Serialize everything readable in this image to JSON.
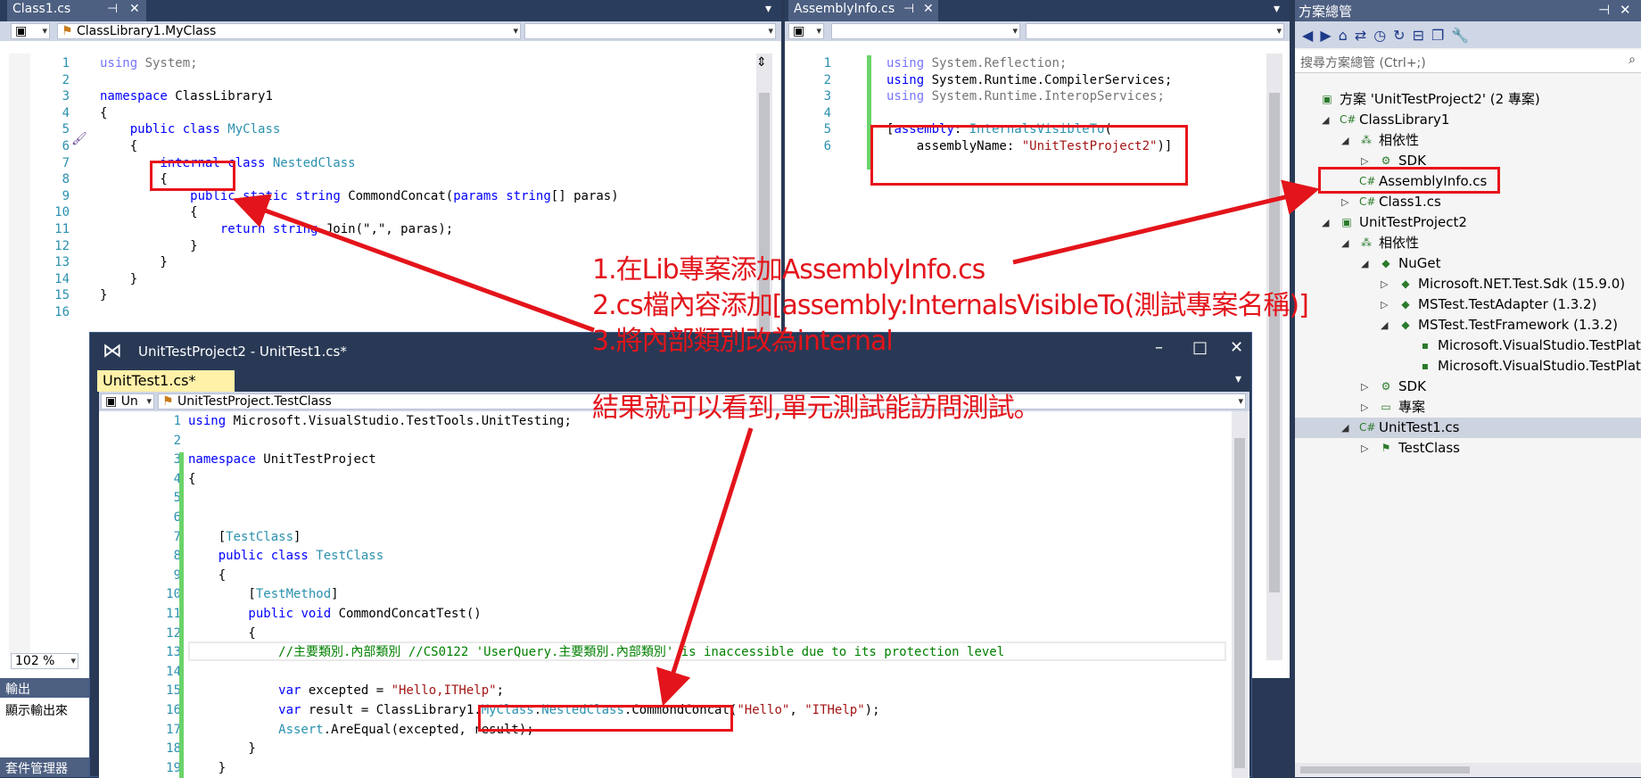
{
  "left_editor": {
    "tab": "Class1.cs",
    "nav_left": "",
    "nav_mid": "ClassLibrary1.MyClass",
    "nav_right": "",
    "zoom": "102 %",
    "gutter": [
      "1",
      "2",
      "3",
      "4",
      "5",
      "6",
      "7",
      "8",
      "9",
      "10",
      "11",
      "12",
      "13",
      "14",
      "15",
      "16"
    ],
    "lines": [
      [
        {
          "t": "using ",
          "c": "kw dim"
        },
        {
          "t": "System;",
          "c": "dim"
        }
      ],
      [],
      [
        {
          "t": "namespace ",
          "c": "kw"
        },
        {
          "t": "ClassLibrary1",
          "c": ""
        }
      ],
      [
        {
          "t": "{",
          "c": ""
        }
      ],
      [
        {
          "t": "    public ",
          "c": "kw"
        },
        {
          "t": "class ",
          "c": "kw"
        },
        {
          "t": "MyClass",
          "c": "ty"
        }
      ],
      [
        {
          "t": "    {",
          "c": ""
        }
      ],
      [
        {
          "t": "        internal ",
          "c": "kw"
        },
        {
          "t": "class ",
          "c": "kw"
        },
        {
          "t": "NestedClass",
          "c": "ty"
        }
      ],
      [
        {
          "t": "        {",
          "c": ""
        }
      ],
      [
        {
          "t": "            public ",
          "c": "kw"
        },
        {
          "t": "static ",
          "c": "kw"
        },
        {
          "t": "string ",
          "c": "kw"
        },
        {
          "t": "CommondConcat(",
          "c": ""
        },
        {
          "t": "params ",
          "c": "kw"
        },
        {
          "t": "string",
          "c": "kw"
        },
        {
          "t": "[] paras)",
          "c": ""
        }
      ],
      [
        {
          "t": "            {",
          "c": ""
        }
      ],
      [
        {
          "t": "                return ",
          "c": "kw"
        },
        {
          "t": "string",
          "c": "kw"
        },
        {
          "t": ".Join(\",\", paras);",
          "c": ""
        }
      ],
      [
        {
          "t": "            }",
          "c": ""
        }
      ],
      [
        {
          "t": "        }",
          "c": ""
        }
      ],
      [
        {
          "t": "    }",
          "c": ""
        }
      ],
      [
        {
          "t": "}",
          "c": ""
        }
      ],
      []
    ]
  },
  "output": {
    "title": "輸出",
    "label": "顯示輸出來",
    "pkg": "套件管理器"
  },
  "mid_editor": {
    "tab": "AssemblyInfo.cs",
    "gutter": [
      "1",
      "2",
      "3",
      "4",
      "5",
      "6"
    ],
    "lines": [
      [
        {
          "t": "using ",
          "c": "kw dim"
        },
        {
          "t": "System.Reflection;",
          "c": "dim"
        }
      ],
      [
        {
          "t": "using ",
          "c": "kw"
        },
        {
          "t": "System.Runtime.CompilerServices;",
          "c": ""
        }
      ],
      [
        {
          "t": "using ",
          "c": "kw dim"
        },
        {
          "t": "System.Runtime.InteropServices;",
          "c": "dim"
        }
      ],
      [],
      [
        {
          "t": "[",
          "c": ""
        },
        {
          "t": "assembly",
          "c": "kw"
        },
        {
          "t": ": ",
          "c": ""
        },
        {
          "t": "InternalsVisibleTo",
          "c": "ty"
        },
        {
          "t": "(",
          "c": ""
        }
      ],
      [
        {
          "t": "    assemblyName: ",
          "c": ""
        },
        {
          "t": "\"UnitTestProject2\"",
          "c": "str"
        },
        {
          "t": ")]",
          "c": ""
        }
      ]
    ]
  },
  "solution_explorer": {
    "title": "方案總管",
    "search_placeholder": "搜尋方案總管 (Ctrl+;)",
    "rows": [
      {
        "label": "方案 'UnitTestProject2' (2 專案)",
        "indent": 0,
        "arrow": "",
        "icon": "▣"
      },
      {
        "label": "ClassLibrary1",
        "indent": 1,
        "arrow": "◢",
        "icon": "C#"
      },
      {
        "label": "相依性",
        "indent": 2,
        "arrow": "◢",
        "icon": "⁂"
      },
      {
        "label": "SDK",
        "indent": 3,
        "arrow": "▷",
        "icon": "⚙"
      },
      {
        "label": "AssemblyInfo.cs",
        "indent": 2,
        "arrow": "",
        "icon": "C#"
      },
      {
        "label": "Class1.cs",
        "indent": 2,
        "arrow": "▷",
        "icon": "C#"
      },
      {
        "label": "UnitTestProject2",
        "indent": 1,
        "arrow": "◢",
        "icon": "▣"
      },
      {
        "label": "相依性",
        "indent": 2,
        "arrow": "◢",
        "icon": "⁂"
      },
      {
        "label": "NuGet",
        "indent": 3,
        "arrow": "◢",
        "icon": "◆"
      },
      {
        "label": "Microsoft.NET.Test.Sdk (15.9.0)",
        "indent": 4,
        "arrow": "▷",
        "icon": "◆"
      },
      {
        "label": "MSTest.TestAdapter (1.3.2)",
        "indent": 4,
        "arrow": "▷",
        "icon": "◆"
      },
      {
        "label": "MSTest.TestFramework (1.3.2)",
        "indent": 4,
        "arrow": "◢",
        "icon": "◆"
      },
      {
        "label": "Microsoft.VisualStudio.TestPlatform",
        "indent": 5,
        "arrow": "",
        "icon": "▪"
      },
      {
        "label": "Microsoft.VisualStudio.TestPlatform",
        "indent": 5,
        "arrow": "",
        "icon": "▪"
      },
      {
        "label": "SDK",
        "indent": 3,
        "arrow": "▷",
        "icon": "⚙"
      },
      {
        "label": "專案",
        "indent": 3,
        "arrow": "▷",
        "icon": "▭"
      },
      {
        "label": "UnitTest1.cs",
        "indent": 2,
        "arrow": "◢",
        "icon": "C#"
      },
      {
        "label": "TestClass",
        "indent": 3,
        "arrow": "▷",
        "icon": "⚑"
      }
    ]
  },
  "float_window": {
    "title": "UnitTestProject2 - UnitTest1.cs*",
    "tab": "UnitTest1.cs*",
    "nav_left": "Un",
    "nav_mid": "UnitTestProject.TestClass",
    "gutter": [
      "1",
      "2",
      "3",
      "4",
      "5",
      "6",
      "7",
      "8",
      "9",
      "10",
      "11",
      "12",
      "13",
      "14",
      "15",
      "16",
      "17",
      "18",
      "19"
    ],
    "lines": [
      [
        {
          "t": "using ",
          "c": "kw"
        },
        {
          "t": "Microsoft.VisualStudio.TestTools.UnitTesting;",
          "c": ""
        }
      ],
      [],
      [
        {
          "t": "namespace ",
          "c": "kw"
        },
        {
          "t": "UnitTestProject",
          "c": ""
        }
      ],
      [
        {
          "t": "{",
          "c": ""
        }
      ],
      [],
      [],
      [
        {
          "t": "    [",
          "c": ""
        },
        {
          "t": "TestClass",
          "c": "ty"
        },
        {
          "t": "]",
          "c": ""
        }
      ],
      [
        {
          "t": "    public ",
          "c": "kw"
        },
        {
          "t": "class ",
          "c": "kw"
        },
        {
          "t": "TestClass",
          "c": "ty"
        }
      ],
      [
        {
          "t": "    {",
          "c": ""
        }
      ],
      [
        {
          "t": "        [",
          "c": ""
        },
        {
          "t": "TestMethod",
          "c": "ty"
        },
        {
          "t": "]",
          "c": ""
        }
      ],
      [
        {
          "t": "        public ",
          "c": "kw"
        },
        {
          "t": "void ",
          "c": "kw"
        },
        {
          "t": "CommondConcatTest()",
          "c": ""
        }
      ],
      [
        {
          "t": "        {",
          "c": ""
        }
      ],
      [
        {
          "t": "            //主要類別.內部類別 //CS0122 'UserQuery.主要類別.內部類別' is inaccessible due to its protection level",
          "c": "cm"
        }
      ],
      [],
      [
        {
          "t": "            var ",
          "c": "kw"
        },
        {
          "t": "excepted = ",
          "c": ""
        },
        {
          "t": "\"Hello,ITHelp\"",
          "c": "str"
        },
        {
          "t": ";",
          "c": ""
        }
      ],
      [
        {
          "t": "            var ",
          "c": "kw"
        },
        {
          "t": "result = ClassLibrary1.",
          "c": ""
        },
        {
          "t": "MyClass",
          "c": "ty"
        },
        {
          "t": ".",
          "c": ""
        },
        {
          "t": "NestedClass",
          "c": "ty"
        },
        {
          "t": ".CommondConcat(",
          "c": ""
        },
        {
          "t": "\"Hello\"",
          "c": "str"
        },
        {
          "t": ", ",
          "c": ""
        },
        {
          "t": "\"ITHelp\"",
          "c": "str"
        },
        {
          "t": ");",
          "c": ""
        }
      ],
      [
        {
          "t": "            Assert",
          "c": "ty"
        },
        {
          "t": ".AreEqual(excepted, result);",
          "c": ""
        }
      ],
      [
        {
          "t": "        }",
          "c": ""
        }
      ],
      [
        {
          "t": "    }",
          "c": ""
        }
      ]
    ]
  },
  "annotation": {
    "line1": "1.在Lib專案添加AssemblyInfo.cs",
    "line2": "2.cs檔內容添加[assembly:InternalsVisibleTo(測試專案名稱)]",
    "line3": "3.將內部類別改為internal",
    "result": "結果就可以看到,單元測試能訪問測試。"
  },
  "colors": {
    "annotation": "#e3141b",
    "keyword": "#0000ff",
    "type": "#2b91af",
    "string": "#a31515",
    "comment": "#008000",
    "frame": "#293955"
  }
}
